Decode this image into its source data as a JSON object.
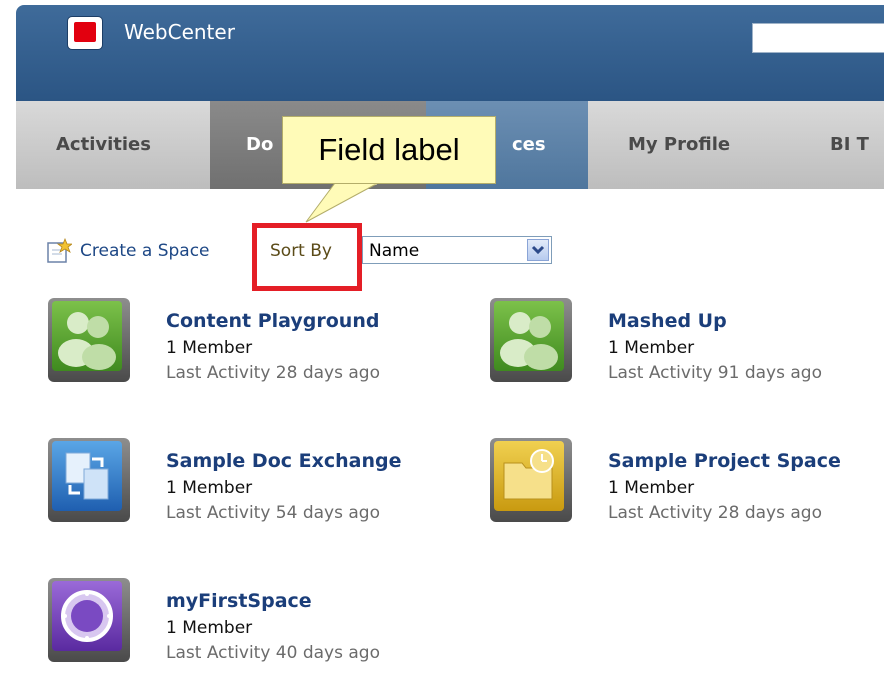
{
  "app": {
    "title": "WebCenter"
  },
  "header": {
    "search_placeholder": ""
  },
  "nav": {
    "tabs": [
      {
        "label": "Activities"
      },
      {
        "label": "Do"
      },
      {
        "label": "ces"
      },
      {
        "label": "My Profile"
      },
      {
        "label": "BI T"
      }
    ]
  },
  "callout": {
    "text": "Field label"
  },
  "toolbar": {
    "create_label": "Create a Space",
    "sort_label": "Sort By",
    "sort_value": "Name"
  },
  "spaces": [
    {
      "name": "Content Playground",
      "members": "1 Member",
      "activity": "Last Activity 28 days ago",
      "icon": "people-icon"
    },
    {
      "name": "Mashed Up",
      "members": "1 Member",
      "activity": "Last Activity 91 days ago",
      "icon": "people-icon"
    },
    {
      "name": "Sample Doc Exchange",
      "members": "1 Member",
      "activity": "Last Activity 54 days ago",
      "icon": "document-exchange-icon"
    },
    {
      "name": "Sample Project Space",
      "members": "1 Member",
      "activity": "Last Activity 28 days ago",
      "icon": "folder-clock-icon"
    },
    {
      "name": "myFirstSpace",
      "members": "1 Member",
      "activity": "Last Activity 40 days ago",
      "icon": "porthole-icon"
    }
  ],
  "colors": {
    "header": "#2b5584",
    "active_tab": "#5a80a6",
    "link": "#1b3e7a",
    "highlight_border": "#e41e26",
    "callout_bg": "#fffbb8"
  }
}
